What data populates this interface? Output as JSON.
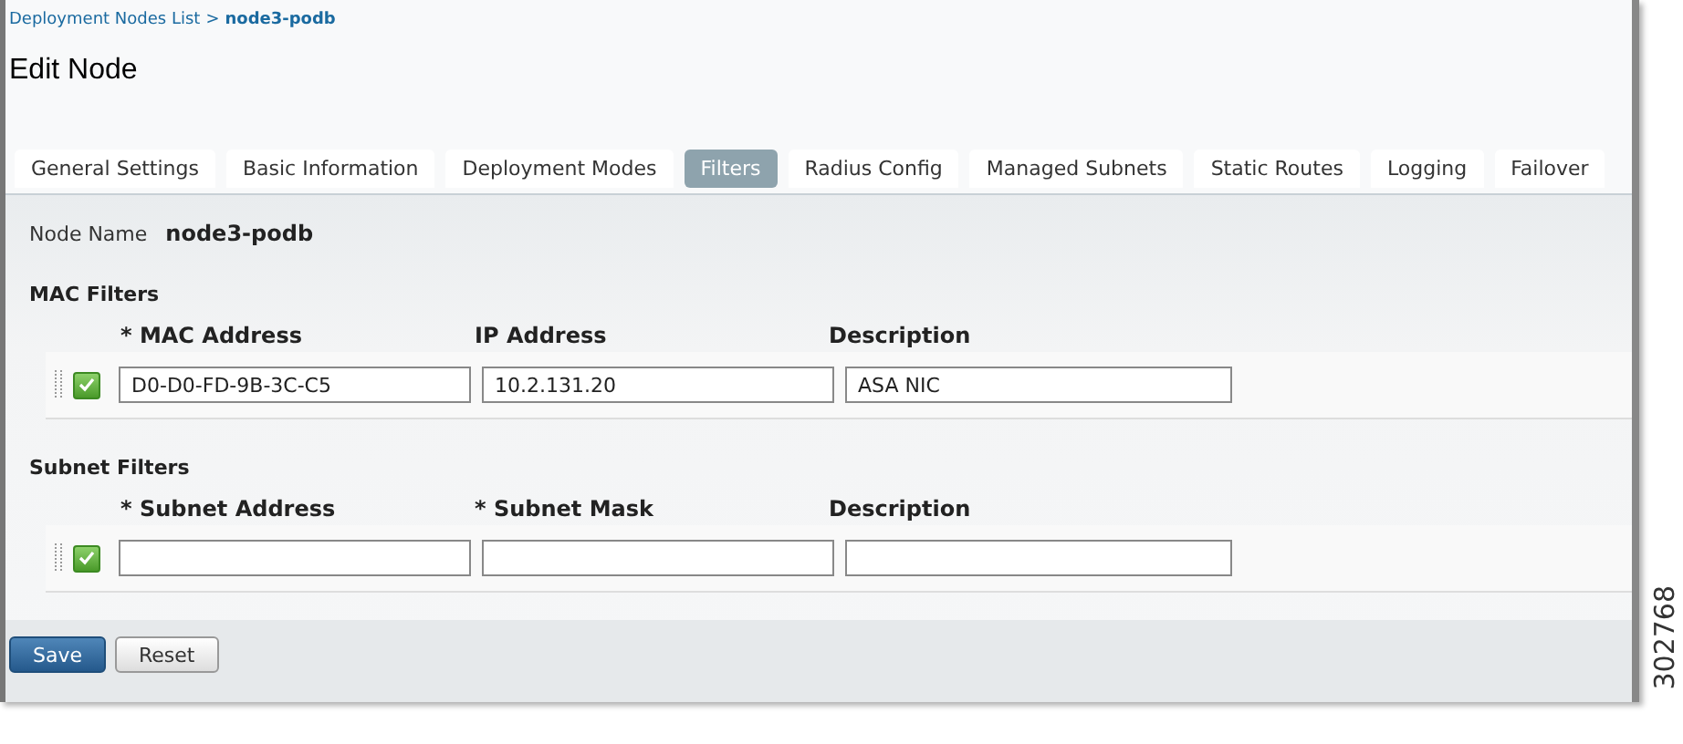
{
  "breadcrumb": {
    "link": "Deployment Nodes List",
    "separator": ">",
    "current": "node3-podb"
  },
  "title": "Edit Node",
  "tabs": [
    {
      "label": "General Settings",
      "selected": false
    },
    {
      "label": "Basic Information",
      "selected": false
    },
    {
      "label": "Deployment Modes",
      "selected": false
    },
    {
      "label": "Filters",
      "selected": true
    },
    {
      "label": "Radius Config",
      "selected": false
    },
    {
      "label": "Managed Subnets",
      "selected": false
    },
    {
      "label": "Static Routes",
      "selected": false
    },
    {
      "label": "Logging",
      "selected": false
    },
    {
      "label": "Failover",
      "selected": false
    }
  ],
  "node_name": {
    "label": "Node Name",
    "value": "node3-podb"
  },
  "sections": [
    {
      "heading": "MAC Filters",
      "columns": [
        "* MAC Address",
        "IP Address",
        "Description"
      ],
      "rows": [
        {
          "checked": true,
          "values": [
            "D0-D0-FD-9B-3C-C5",
            "10.2.131.20",
            "ASA NIC"
          ]
        }
      ]
    },
    {
      "heading": "Subnet Filters",
      "columns": [
        "* Subnet Address",
        "* Subnet Mask",
        "Description"
      ],
      "rows": [
        {
          "checked": true
        }
      ]
    }
  ],
  "buttons": [
    {
      "label": "Save",
      "kind": "primary"
    },
    {
      "label": "Reset",
      "kind": "secondary"
    }
  ],
  "figure_number": "302768"
}
